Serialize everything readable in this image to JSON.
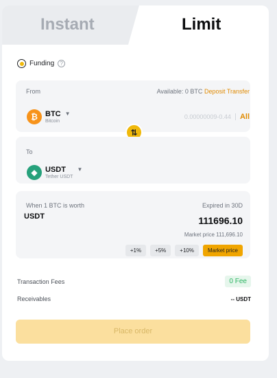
{
  "tabs": {
    "instant": "Instant",
    "limit": "Limit"
  },
  "funding": {
    "label": "Funding",
    "help_icon": "?"
  },
  "from": {
    "label": "From",
    "available_prefix": "Available: 0 BTC",
    "deposit": "Deposit",
    "transfer": "Transfer",
    "coin": {
      "symbol": "BTC",
      "name": "Bitcoin",
      "icon": "bitcoin-icon",
      "color": "#f7931a"
    },
    "amount_placeholder": "0.00000009-0.44",
    "all": "All"
  },
  "to": {
    "label": "To",
    "coin": {
      "symbol": "USDT",
      "name": "Tether USDT",
      "icon": "tether-icon",
      "color": "#26a17b"
    }
  },
  "price": {
    "label": "When 1 BTC is worth",
    "expired": "Expired in 30D",
    "currency": "USDT",
    "value": "111696.10",
    "market_price": "Market price 111,696.10",
    "buttons": [
      "+1%",
      "+5%",
      "+10%",
      "Market price"
    ]
  },
  "fees": {
    "label": "Transaction Fees",
    "value": "0 Fee"
  },
  "receivables": {
    "label": "Receivables",
    "value": "-- USDT"
  },
  "place_order": "Place order",
  "colors": {
    "accent": "#f0b90b",
    "link": "#e08a00",
    "fee_green": "#2cb462"
  }
}
